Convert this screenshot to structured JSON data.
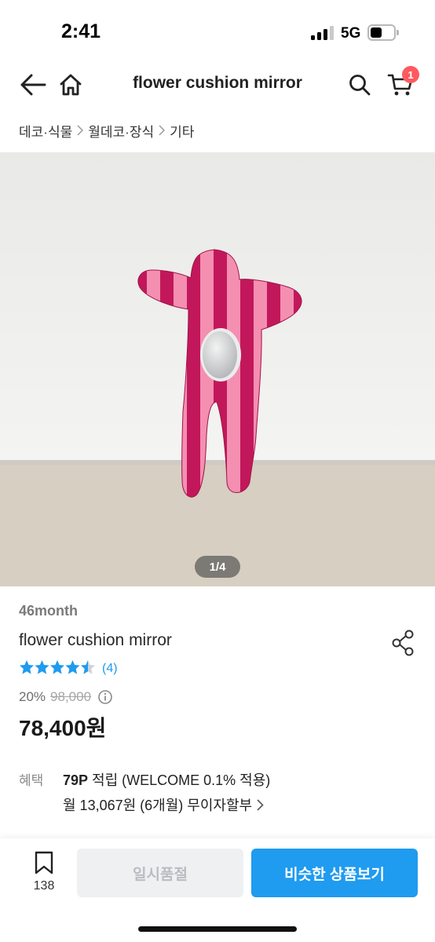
{
  "status_bar": {
    "time": "2:41",
    "network": "5G",
    "battery_level": 0.4
  },
  "nav": {
    "title": "flower cushion mirror",
    "cart_count": "1",
    "icons": [
      "back-arrow-icon",
      "home-icon",
      "search-icon",
      "cart-icon"
    ]
  },
  "breadcrumb": {
    "items": [
      "데코·식물",
      "월데코·장식",
      "기타"
    ]
  },
  "gallery": {
    "counter": "1/4",
    "colors": {
      "wall": "#f1f1ef",
      "floor": "#d5cec2",
      "stripe_dark": "#c2185b",
      "stripe_light": "#f48fb1"
    }
  },
  "product": {
    "seller": "46month",
    "title": "flower cushion mirror",
    "rating_value": 4.5,
    "rating_count": "(4)",
    "discount": "20%",
    "original_price": "98,000",
    "price": "78,400원"
  },
  "benefit": {
    "label": "혜택",
    "points": "79P",
    "points_text": " 적립 (WELCOME 0.1% 적용)",
    "installment": "월 13,067원 (6개월) 무이자할부"
  },
  "bottom_bar": {
    "bookmark_count": "138",
    "sold_out_label": "일시품절",
    "similar_label": "비슷한 상품보기"
  },
  "colors": {
    "accent": "#1f9bf0",
    "badge": "#ff5a5f",
    "star": "#1f9bf0"
  }
}
